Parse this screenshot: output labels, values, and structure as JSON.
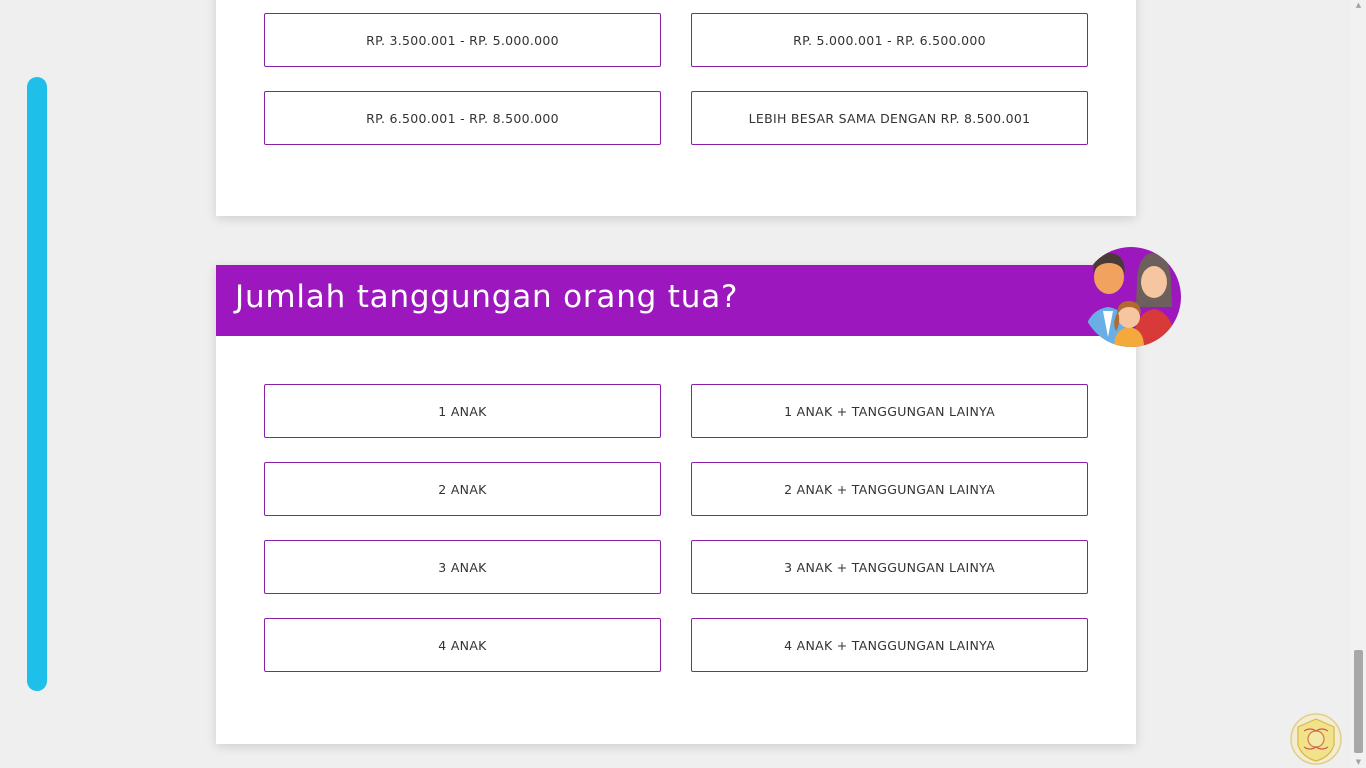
{
  "income_section": {
    "options": [
      "RP. 3.500.001 - RP. 5.000.000",
      "RP. 5.000.001 - RP. 6.500.000",
      "RP. 6.500.001 - RP. 8.500.000",
      "LEBIH BESAR SAMA DENGAN RP. 8.500.001"
    ]
  },
  "dependents_section": {
    "title": "Jumlah tanggungan orang tua?",
    "icon": "family-icon",
    "options": [
      "1 ANAK",
      "1 ANAK + TANGGUNGAN LAINYA",
      "2 ANAK",
      "2 ANAK + TANGGUNGAN LAINYA",
      "3 ANAK",
      "3 ANAK + TANGGUNGAN LAINYA",
      "4 ANAK",
      "4 ANAK + TANGGUNGAN LAINYA"
    ]
  },
  "colors": {
    "accent": "#9c17be",
    "progress": "#1ec0ea",
    "button_border": "#8a1fa8",
    "background": "#efefef"
  }
}
